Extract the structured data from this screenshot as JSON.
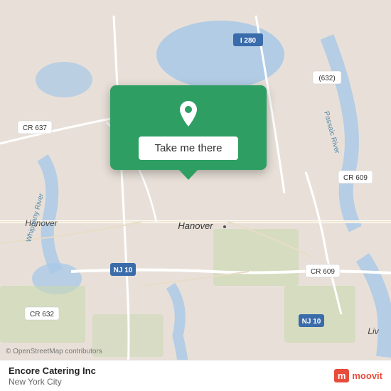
{
  "map": {
    "background_color": "#e8e0d8",
    "center": "Hanover, New Jersey"
  },
  "popup": {
    "background_color": "#2e9e63",
    "button_label": "Take me there",
    "pin_color": "white"
  },
  "bottom_bar": {
    "business_name": "Encore Catering Inc",
    "city": "New York City",
    "attribution_text": "© OpenStreetMap contributors",
    "moovit_label": "moovit"
  },
  "road_labels": {
    "cr637": "CR 637",
    "i280": "I 280",
    "cr632_top": "(632)",
    "cr609_right": "CR 609",
    "cr609_bottom": "CR 609",
    "nj10_left": "NJ 10",
    "nj10_right": "NJ 10",
    "cr632_bottom": "CR 632",
    "hanover_left": "Hanover",
    "hanover_center": "Hanover",
    "passaic_river": "Passaic River",
    "whippany_river": "Whippany River",
    "liv": "Liv"
  }
}
